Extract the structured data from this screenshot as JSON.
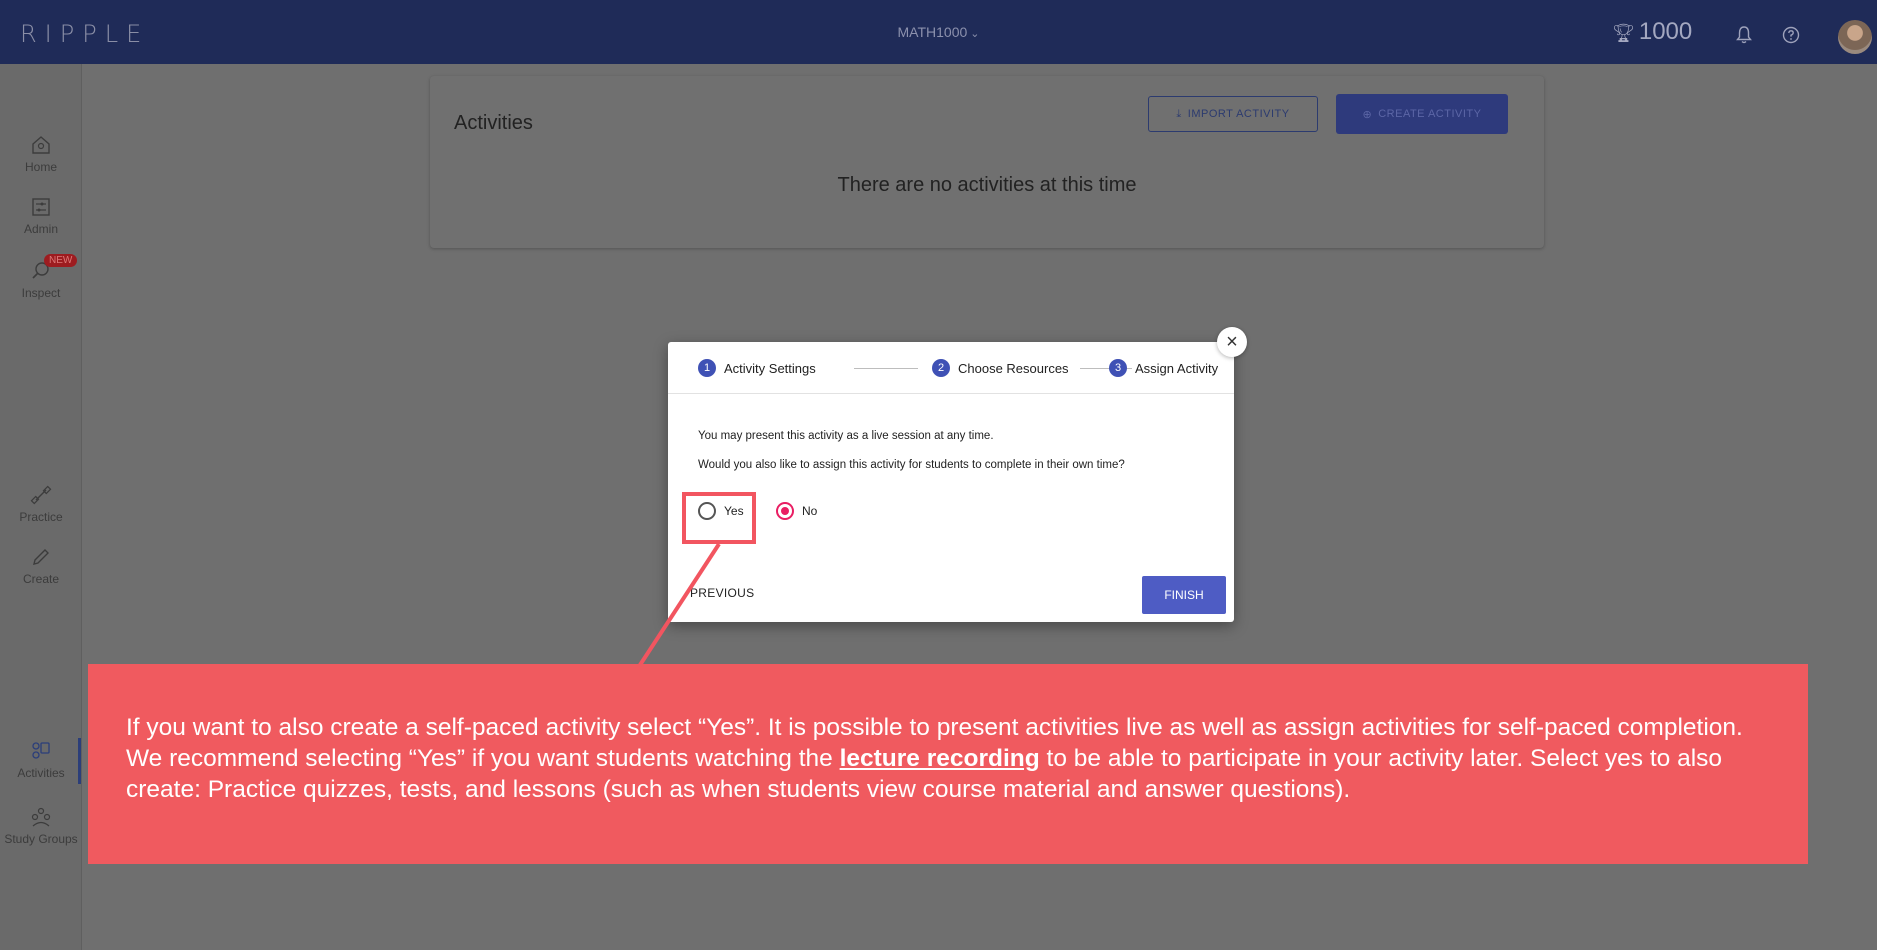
{
  "topbar": {
    "logo": "RIPPLE",
    "course": "MATH1000",
    "points": "1000",
    "icons": [
      "trophy-icon",
      "bell-icon",
      "help-icon"
    ]
  },
  "sidebar": {
    "items": [
      {
        "label": "Home",
        "icon": "home-icon"
      },
      {
        "label": "Admin",
        "icon": "admin-icon"
      },
      {
        "label": "Inspect",
        "icon": "inspect-icon",
        "badge": "NEW"
      },
      {
        "label": "Practice",
        "icon": "dumbbell-icon"
      },
      {
        "label": "Create",
        "icon": "pencil-icon"
      },
      {
        "label": "Activities",
        "icon": "activities-icon"
      },
      {
        "label": "Study Groups",
        "icon": "study-groups-icon"
      }
    ]
  },
  "card": {
    "title": "Activities",
    "import_label": "IMPORT ACTIVITY",
    "create_label": "CREATE ACTIVITY",
    "empty_message": "There are no activities at this time"
  },
  "dialog": {
    "steps": [
      {
        "number": "1",
        "label": "Activity Settings"
      },
      {
        "number": "2",
        "label": "Choose Resources"
      },
      {
        "number": "3",
        "label": "Assign Activity"
      }
    ],
    "line1": "You may present this activity as a live session at any time.",
    "line2": "Would you also like to assign this activity for students to complete in their own time?",
    "options": [
      {
        "label": "Yes",
        "selected": false
      },
      {
        "label": "No",
        "selected": true
      }
    ],
    "previous_label": "PREVIOUS",
    "finish_label": "FINISH"
  },
  "callout": {
    "part1": "If you want to also create a self-paced activity select “Yes”. It is possible to present activities live as well as assign activities for self-paced completion. We recommend selecting “Yes” if you want students watching the ",
    "link": "lecture recording",
    "part2": " to be able to participate in your activity later. Select yes to also create: Practice quizzes, tests, and lessons (such as when students view course material and answer questions)."
  },
  "colors": {
    "topbar": "#1f2b58",
    "accent": "#3f51b5",
    "radio_selected": "#e91e63",
    "callout": "#f05a5f"
  }
}
